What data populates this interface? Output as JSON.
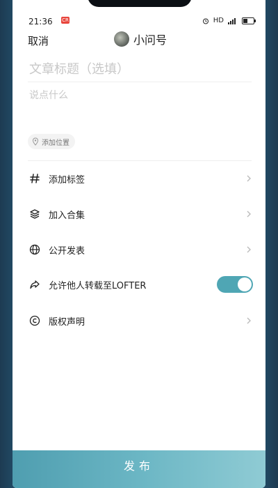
{
  "status_bar": {
    "time": "21:36",
    "rec_badge": "CR",
    "signal_text": "HD"
  },
  "header": {
    "cancel_label": "取消",
    "account_name": "小问号"
  },
  "editor": {
    "title_placeholder": "文章标题（选填）",
    "body_placeholder": "说点什么"
  },
  "location": {
    "label": "添加位置"
  },
  "options": [
    {
      "label": "添加标签",
      "icon": "hashtag-icon"
    },
    {
      "label": "加入合集",
      "icon": "layers-icon"
    },
    {
      "label": "公开发表",
      "icon": "globe-icon"
    },
    {
      "label": "允许他人转载至LOFTER",
      "icon": "share-arrow-icon",
      "toggle_on": true
    },
    {
      "label": "版权声明",
      "icon": "copyright-icon"
    }
  ],
  "publish_label": "发布",
  "colors": {
    "accent": "#4fa6b4",
    "publish_start": "#4f9eb0",
    "publish_end": "#8fcbd4"
  }
}
